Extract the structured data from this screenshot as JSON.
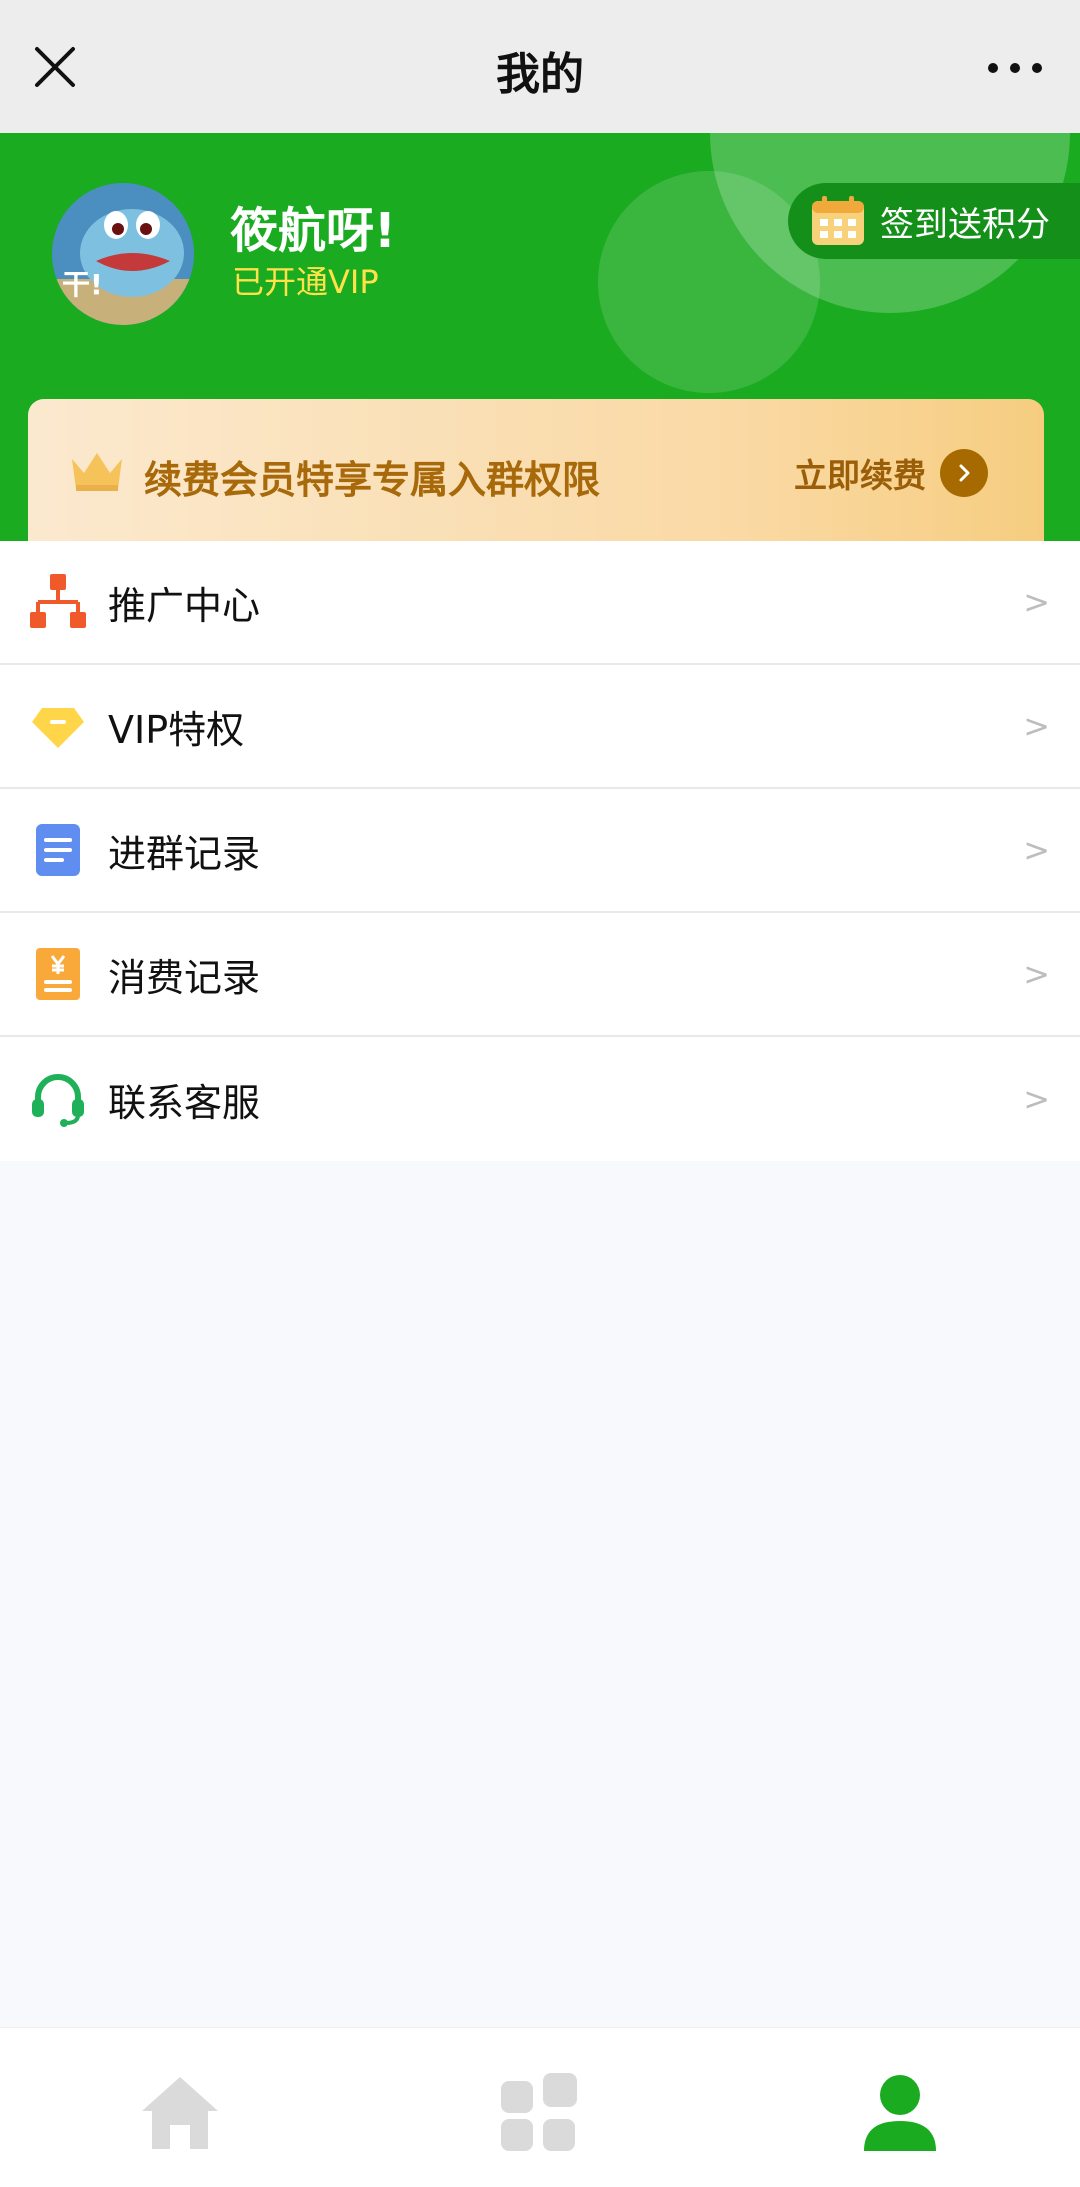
{
  "titlebar": {
    "title": "我的",
    "close_icon": "close-icon",
    "more_icon": "more-icon"
  },
  "profile": {
    "username": "筱航呀!",
    "vip_status": "已开通VIP",
    "avatar_badge": "干!",
    "checkin_label": "签到送积分"
  },
  "banner": {
    "text": "续费会员特享专属入群权限",
    "renew_label": "立即续费"
  },
  "menu": {
    "items": [
      {
        "label": "推广中心",
        "icon": "org-chart-icon",
        "arrow": ">"
      },
      {
        "label": "VIP特权",
        "icon": "diamond-icon",
        "arrow": ">"
      },
      {
        "label": "进群记录",
        "icon": "document-icon",
        "arrow": ">"
      },
      {
        "label": "消费记录",
        "icon": "receipt-icon",
        "arrow": ">"
      },
      {
        "label": "联系客服",
        "icon": "headset-icon",
        "arrow": ">"
      }
    ]
  },
  "tabbar": {
    "tabs": [
      {
        "icon": "home-icon",
        "active": false
      },
      {
        "icon": "apps-icon",
        "active": false
      },
      {
        "icon": "user-icon",
        "active": true
      }
    ]
  },
  "colors": {
    "brand_green": "#1aab20",
    "vip_yellow": "#ffe24a",
    "banner_text": "#a8690a",
    "tab_inactive": "#d9d9d9"
  }
}
